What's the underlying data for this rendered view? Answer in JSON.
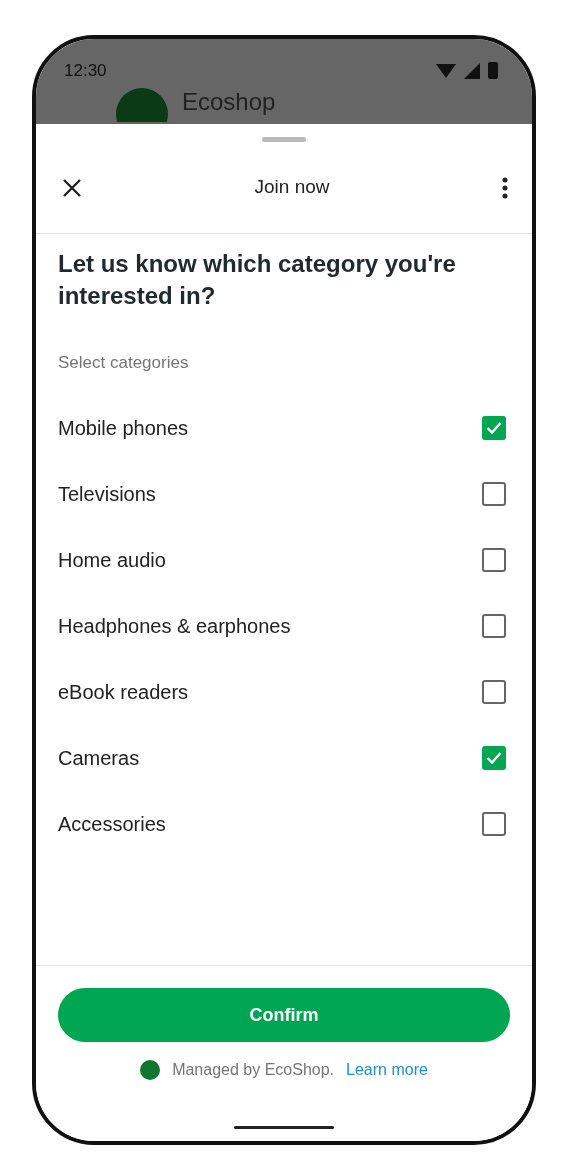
{
  "status_bar": {
    "time": "12:30"
  },
  "background": {
    "shop_name": "Ecoshop"
  },
  "sheet": {
    "title": "Join now",
    "heading": "Let us know which category you're interested in?",
    "section_label": "Select categories",
    "categories": [
      {
        "label": "Mobile phones",
        "checked": true
      },
      {
        "label": "Televisions",
        "checked": false
      },
      {
        "label": "Home audio",
        "checked": false
      },
      {
        "label": "Headphones & earphones",
        "checked": false
      },
      {
        "label": "eBook readers",
        "checked": false
      },
      {
        "label": "Cameras",
        "checked": true
      },
      {
        "label": "Accessories",
        "checked": false
      }
    ],
    "confirm_button": "Confirm",
    "footer": {
      "text": "Managed by EcoShop.",
      "link": "Learn more"
    }
  }
}
